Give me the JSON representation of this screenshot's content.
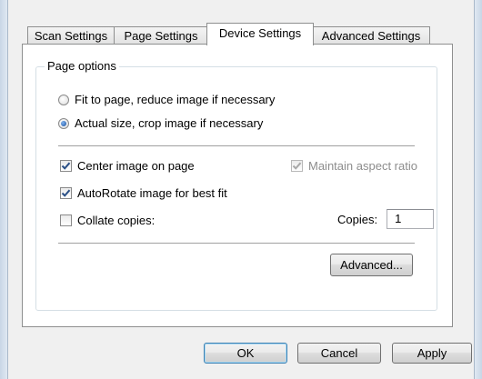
{
  "tabs": [
    {
      "label": "Scan Settings",
      "active": false
    },
    {
      "label": "Page Settings",
      "active": false
    },
    {
      "label": "Device Settings",
      "active": true
    },
    {
      "label": "Advanced Settings",
      "active": false
    }
  ],
  "page_options": {
    "title": "Page options",
    "fit_radio": {
      "label": "Fit to page, reduce image if necessary",
      "checked": false
    },
    "actual_radio": {
      "label": "Actual size, crop image if necessary",
      "checked": true
    },
    "center_check": {
      "label": "Center image on page",
      "checked": true
    },
    "aspect_check": {
      "label": "Maintain aspect ratio",
      "checked": true,
      "enabled": false
    },
    "autorotate_check": {
      "label": "AutoRotate image for best fit",
      "checked": true
    },
    "collate_check": {
      "label": "Collate copies:",
      "checked": false
    },
    "copies": {
      "label": "Copies:",
      "value": "1"
    },
    "advanced_button": "Advanced..."
  },
  "buttons": {
    "ok": "OK",
    "cancel": "Cancel",
    "apply": "Apply"
  }
}
